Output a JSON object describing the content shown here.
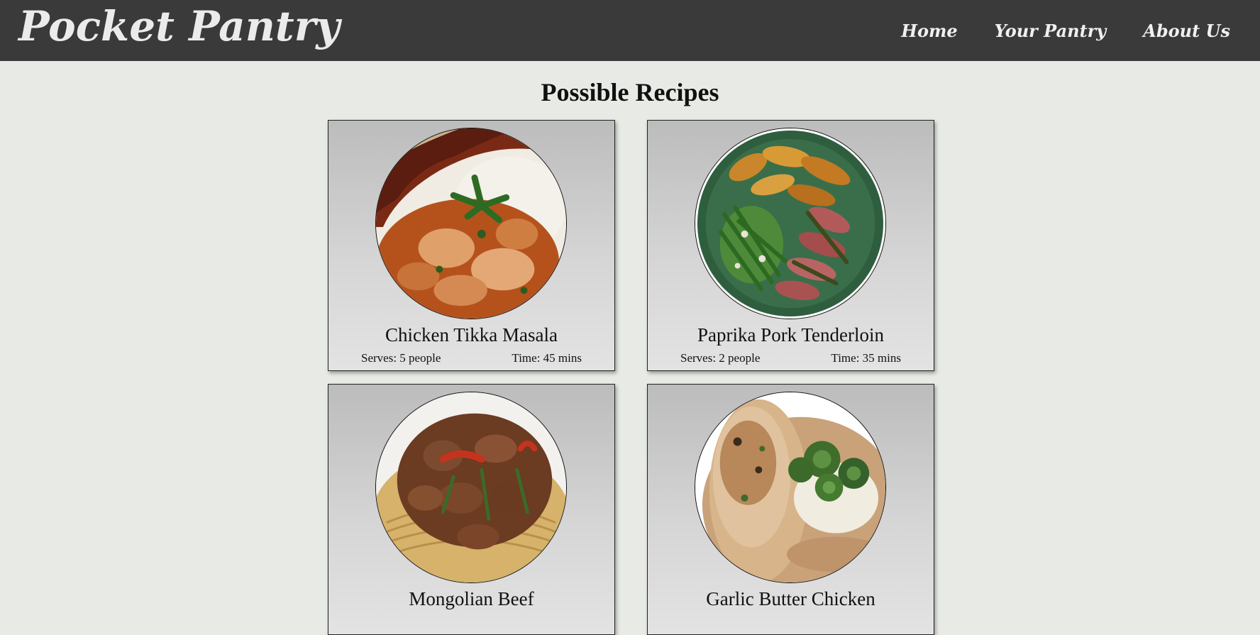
{
  "brand": {
    "name": "Pocket Pantry"
  },
  "nav": {
    "items": [
      {
        "label": "Home"
      },
      {
        "label": "Your Pantry"
      },
      {
        "label": "About Us"
      }
    ]
  },
  "page": {
    "title": "Possible Recipes"
  },
  "recipes": [
    {
      "title": "Chicken Tikka Masala",
      "serves": "Serves: 5 people",
      "time": "Time: 45 mins",
      "image": "chicken-tikka-masala-photo"
    },
    {
      "title": "Paprika Pork Tenderloin",
      "serves": "Serves: 2 people",
      "time": "Time: 35 mins",
      "image": "paprika-pork-tenderloin-photo"
    },
    {
      "title": "Mongolian Beef",
      "serves": "",
      "time": "",
      "image": "mongolian-beef-photo"
    },
    {
      "title": "Garlic Butter Chicken",
      "serves": "",
      "time": "",
      "image": "garlic-butter-chicken-photo"
    }
  ],
  "colors": {
    "nav_background": "#3a3a3a",
    "page_background": "#e8ebe5",
    "nav_text": "#f0f0f0"
  }
}
